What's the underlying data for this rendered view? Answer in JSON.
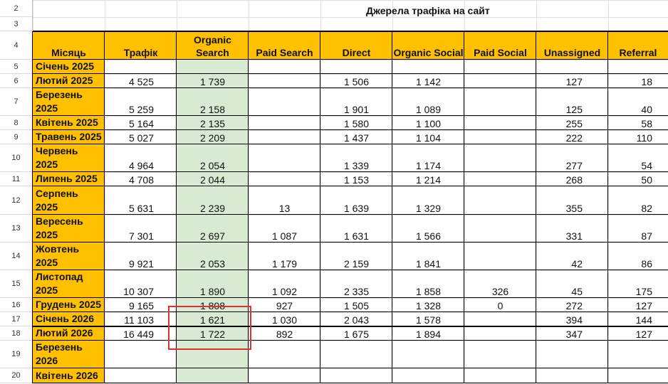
{
  "title": "Джерела трафіка на сайт",
  "row_numbers": [
    "2",
    "3",
    "4",
    "5",
    "6",
    "7",
    "8",
    "9",
    "10",
    "11",
    "12",
    "13",
    "14",
    "15",
    "16",
    "17",
    "18",
    "19",
    "20"
  ],
  "headers": [
    "Місяць",
    "Трафік",
    "Organic Search",
    "Paid Search",
    "Direct",
    "Organic Social",
    "Paid Social",
    "Unassigned",
    "Referral"
  ],
  "rows": [
    {
      "month": "Січень 2025",
      "cells": [
        "",
        "",
        "",
        "",
        "",
        "",
        "",
        ""
      ]
    },
    {
      "month": "Лютий 2025",
      "cells": [
        "4 525",
        "1 739",
        "",
        "1 506",
        "1 142",
        "",
        "127",
        "18"
      ]
    },
    {
      "month": "Березень 2025",
      "cells": [
        "5 259",
        "2 158",
        "",
        "1 901",
        "1 089",
        "",
        "125",
        "40"
      ]
    },
    {
      "month": "Квітень 2025",
      "cells": [
        "5 164",
        "2 135",
        "",
        "1 580",
        "1 100",
        "",
        "255",
        "58"
      ]
    },
    {
      "month": "Травень 2025",
      "cells": [
        "5 027",
        "2 209",
        "",
        "1 437",
        "1 104",
        "",
        "222",
        "110"
      ]
    },
    {
      "month": "Червень 2025",
      "cells": [
        "4 964",
        "2 054",
        "",
        "1 339",
        "1 174",
        "",
        "277",
        "54"
      ]
    },
    {
      "month": "Липень 2025",
      "cells": [
        "4 708",
        "2 044",
        "",
        "1 153",
        "1 214",
        "",
        "268",
        "50"
      ]
    },
    {
      "month": "Серпень 2025",
      "cells": [
        "5 631",
        "2 239",
        "13",
        "1 639",
        "1 329",
        "",
        "355",
        "82"
      ]
    },
    {
      "month": "Вересень 2025",
      "cells": [
        "7 301",
        "2 697",
        "1 087",
        "1 631",
        "1 566",
        "",
        "331",
        "87"
      ]
    },
    {
      "month": "Жовтень 2025",
      "cells": [
        "9 921",
        "2 053",
        "1 179",
        "2 159",
        "1 841",
        "",
        "42",
        "86"
      ]
    },
    {
      "month": "Листопад 2025",
      "cells": [
        "10 307",
        "1 890",
        "1 092",
        "2 335",
        "1 858",
        "326",
        "45",
        "175"
      ]
    },
    {
      "month": "Грудень 2025",
      "cells": [
        "9 165",
        "1 808",
        "927",
        "1 505",
        "1 328",
        "0",
        "272",
        "127"
      ]
    },
    {
      "month": "Січень 2026",
      "cells": [
        "11 103",
        "1 621",
        "1 030",
        "2 043",
        "1 578",
        "",
        "394",
        "144"
      ]
    },
    {
      "month": "Лютий 2026",
      "cells": [
        "16 449",
        "1 722",
        "892",
        "1 675",
        "1 894",
        "",
        "347",
        "127"
      ]
    },
    {
      "month": "Березень 2026",
      "cells": [
        "",
        "",
        "",
        "",
        "",
        "",
        "",
        ""
      ]
    },
    {
      "month": "Квітень 2026",
      "cells": [
        "",
        "",
        "",
        "",
        "",
        "",
        "",
        ""
      ]
    }
  ]
}
